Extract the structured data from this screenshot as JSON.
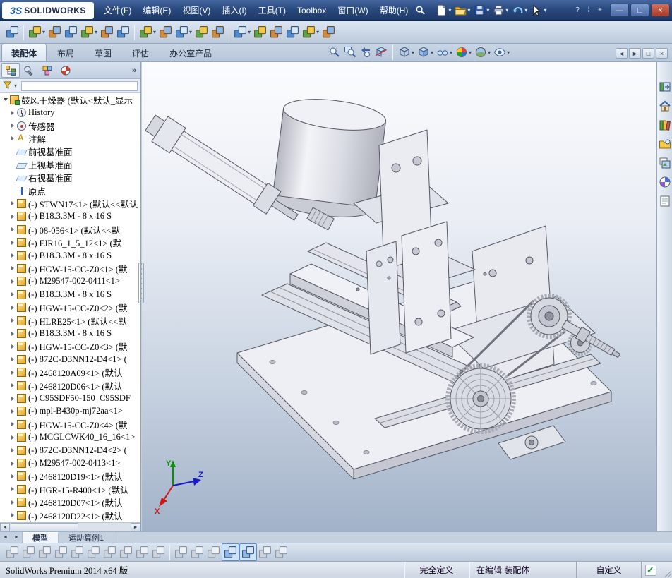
{
  "window": {
    "logo_mark": "3S",
    "logo_text": "SOLIDWORKS"
  },
  "menu": {
    "items": [
      "文件(F)",
      "编辑(E)",
      "视图(V)",
      "插入(I)",
      "工具(T)",
      "Toolbox",
      "窗口(W)",
      "帮助(H)"
    ]
  },
  "command_tabs": {
    "active": "装配体",
    "items": [
      "装配体",
      "布局",
      "草图",
      "评估",
      "办公室产品"
    ]
  },
  "feature_tree": {
    "root": "鼓风干燥器 (默认<默认_显示",
    "items": [
      {
        "icon": "history",
        "label": "History"
      },
      {
        "icon": "sensors",
        "label": "传感器"
      },
      {
        "icon": "annotations",
        "label": "注解"
      },
      {
        "icon": "plane",
        "label": "前视基准面"
      },
      {
        "icon": "plane",
        "label": "上视基准面"
      },
      {
        "icon": "plane",
        "label": "右视基准面"
      },
      {
        "icon": "origin",
        "label": "原点"
      },
      {
        "icon": "part",
        "label": "(-) STWN17<1> (默认<<默认"
      },
      {
        "icon": "part",
        "label": "(-) B18.3.3M - 8 x 16 S"
      },
      {
        "icon": "part",
        "label": "(-) 08-056<1> (默认<<默"
      },
      {
        "icon": "part",
        "label": "(-) FJR16_1_5_12<1> (默"
      },
      {
        "icon": "part",
        "label": "(-) B18.3.3M - 8 x 16 S"
      },
      {
        "icon": "part",
        "label": "(-) HGW-15-CC-Z0<1> (默"
      },
      {
        "icon": "part",
        "label": "(-) M29547-002-0411<1>"
      },
      {
        "icon": "part",
        "label": "(-) B18.3.3M - 8 x 16 S"
      },
      {
        "icon": "part",
        "label": "(-) HGW-15-CC-Z0<2> (默"
      },
      {
        "icon": "part",
        "label": "(-) HLRE25<1> (默认<<默"
      },
      {
        "icon": "part",
        "label": "(-) B18.3.3M - 8 x 16 S"
      },
      {
        "icon": "part",
        "label": "(-) HGW-15-CC-Z0<3> (默"
      },
      {
        "icon": "part",
        "label": "(-) 872C-D3NN12-D4<1> ("
      },
      {
        "icon": "part",
        "label": "(-) 2468120A09<1> (默认"
      },
      {
        "icon": "part",
        "label": "(-) 2468120D06<1> (默认"
      },
      {
        "icon": "part",
        "label": "(-) C95SDF50-150_C95SDF"
      },
      {
        "icon": "part",
        "label": "(-) mpl-B430p-mj72aa<1>"
      },
      {
        "icon": "part",
        "label": "(-) HGW-15-CC-Z0<4> (默"
      },
      {
        "icon": "part",
        "label": "(-) MCGLCWK40_16_16<1>"
      },
      {
        "icon": "part",
        "label": "(-) 872C-D3NN12-D4<2> ("
      },
      {
        "icon": "part",
        "label": "(-) M29547-002-0413<1>"
      },
      {
        "icon": "part",
        "label": "(-) 2468120D19<1> (默认"
      },
      {
        "icon": "part",
        "label": "(-) HGR-15-R400<1> (默认"
      },
      {
        "icon": "part",
        "label": "(-) 2468120D07<1> (默认"
      },
      {
        "icon": "part",
        "label": "(-) 2468120D22<1> (默认"
      }
    ]
  },
  "doc_tabs": {
    "active": "模型",
    "items": [
      "模型",
      "运动算例1"
    ]
  },
  "status": {
    "product": "SolidWorks Premium 2014 x64 版",
    "state": "完全定义",
    "editing": "在编辑 装配体",
    "view_mode": "自定义"
  },
  "icons": {
    "caret": "▾",
    "chevron": "»",
    "left_arrow": "◄",
    "right_arrow": "►",
    "minimize": "—",
    "restore": "□",
    "close": "×",
    "check": "✓"
  },
  "colors": {
    "titlebar_blue": "#2a4a7e",
    "tree_part_gold": "#e3b33c",
    "status_check_green": "#1d9e3a",
    "axis_x_red": "#cc1717",
    "axis_y_green": "#0b8f0b",
    "axis_z_blue": "#1a1acd"
  }
}
